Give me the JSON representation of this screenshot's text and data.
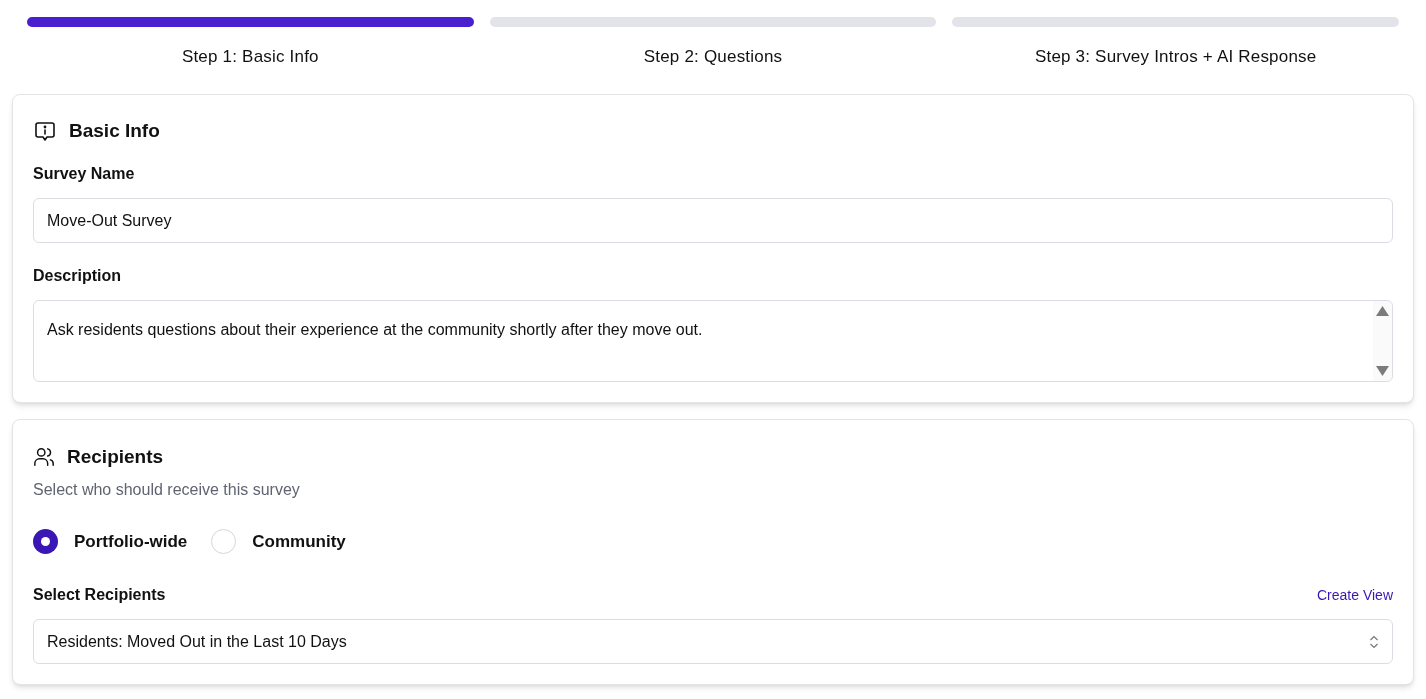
{
  "steps": [
    {
      "label": "Step 1: Basic Info",
      "selected": true
    },
    {
      "label": "Step 2: Questions",
      "selected": false
    },
    {
      "label": "Step 3: Survey Intros + AI Response",
      "selected": false
    }
  ],
  "basic_info": {
    "title": "Basic Info",
    "name_label": "Survey Name",
    "name_value": "Move-Out Survey",
    "description_label": "Description",
    "description_value": "Ask residents questions about their experience at the community shortly after they move out."
  },
  "recipients": {
    "title": "Recipients",
    "subtitle": "Select who should receive this survey",
    "options": [
      {
        "label": "Portfolio-wide",
        "selected": true
      },
      {
        "label": "Community",
        "selected": false
      }
    ],
    "select_label": "Select Recipients",
    "create_link": "Create View",
    "select_value": "Residents: Moved Out in the Last 10 Days"
  }
}
